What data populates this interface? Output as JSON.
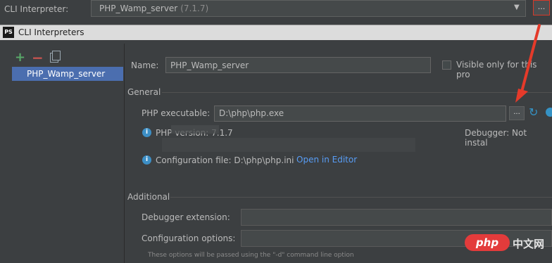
{
  "top": {
    "cli_label": "CLI Interpreter:",
    "combo_value": "PHP_Wamp_server",
    "combo_version": "(7.1.7)",
    "dots": "..."
  },
  "dialog": {
    "title": "CLI Interpreters",
    "logo_text": "PS"
  },
  "toolbar": {
    "add": "+",
    "remove": "−"
  },
  "list": {
    "items": [
      "PHP_Wamp_server"
    ]
  },
  "form": {
    "name_label": "Name:",
    "name_value": "PHP_Wamp_server",
    "visible_label": "Visible only for this pro",
    "general_title": "General",
    "php_exe_label": "PHP executable:",
    "php_exe_value": "D:\\php\\php.exe",
    "php_exe_dots": "...",
    "php_version_label": "PHP version: 7.1.7",
    "debugger_label": "Debugger: Not instal",
    "config_label": "Configuration file: D:\\php\\php.ini",
    "open_editor": "Open in Editor",
    "additional_title": "Additional",
    "dbg_ext_label": "Debugger extension:",
    "conf_opt_label": "Configuration options:",
    "hint": "These options will be passed using the \"-d\" command line option"
  },
  "watermark": {
    "badge": "php",
    "text": "中文网"
  },
  "colors": {
    "accent_selection": "#4b6eaf",
    "annotation_red": "#e53a2a",
    "link": "#589df6"
  }
}
